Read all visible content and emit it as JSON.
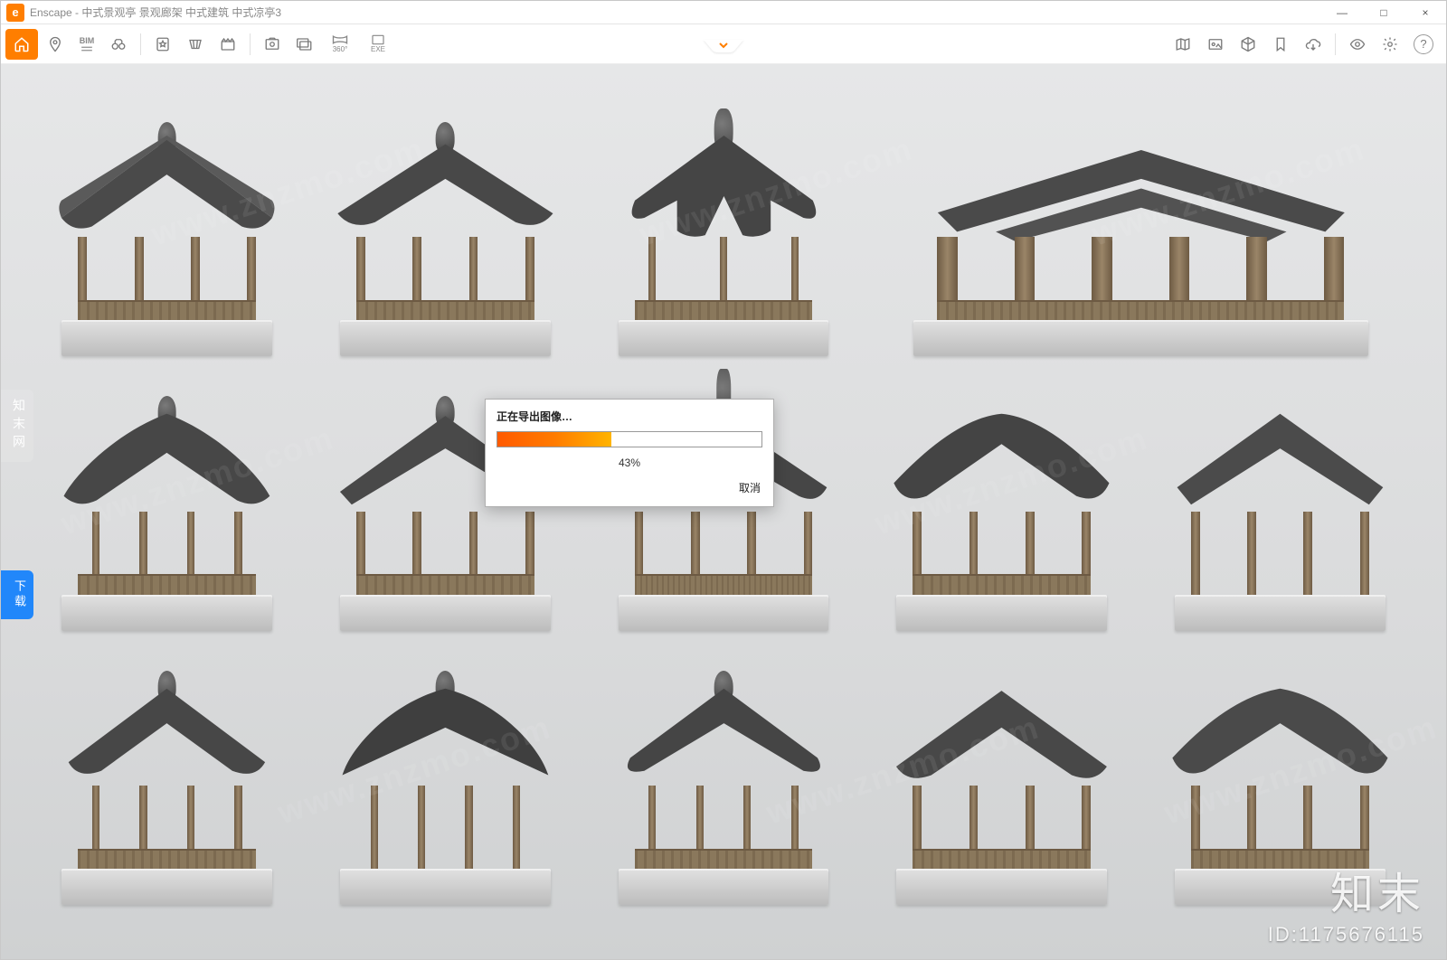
{
  "app": {
    "name": "Enscape",
    "icon_letter": "e"
  },
  "titlebar": {
    "title": "Enscape - 中式景观亭 景观廊架 中式建筑 中式凉亭3"
  },
  "window_controls": {
    "minimize": "—",
    "maximize": "□",
    "close": "×"
  },
  "toolbar_left": {
    "home": "home-icon",
    "pin": "pin-icon",
    "bim_label": "BIM",
    "binoculars": "binoculars-icon",
    "favorite": "favorite-icon",
    "perspective": "perspective-icon",
    "clapper": "clapperboard-icon",
    "screenshot": "screenshot-icon",
    "batch": "batch-render-icon",
    "pano360_label": "360°",
    "exe_label": "EXE"
  },
  "toolbar_right": {
    "map": "map-icon",
    "asset": "asset-library-icon",
    "cube": "cube-icon",
    "bookmark": "bookmark-icon",
    "cloud": "cloud-icon",
    "eye": "visual-settings-icon",
    "gear": "settings-icon",
    "help_char": "?"
  },
  "dialog": {
    "title": "正在导出图像…",
    "percent_value": 43,
    "percent_label": "43%",
    "cancel": "取消"
  },
  "watermarks": {
    "text": "www.znzmo.com"
  },
  "brand": {
    "name": "知末",
    "id_label": "ID:1175676115"
  },
  "left_badges": {
    "badge1": "知末网",
    "badge2": "下载"
  },
  "colors": {
    "accent": "#ff7e00",
    "progress_start": "#ff5a00",
    "progress_end": "#ffb400"
  }
}
